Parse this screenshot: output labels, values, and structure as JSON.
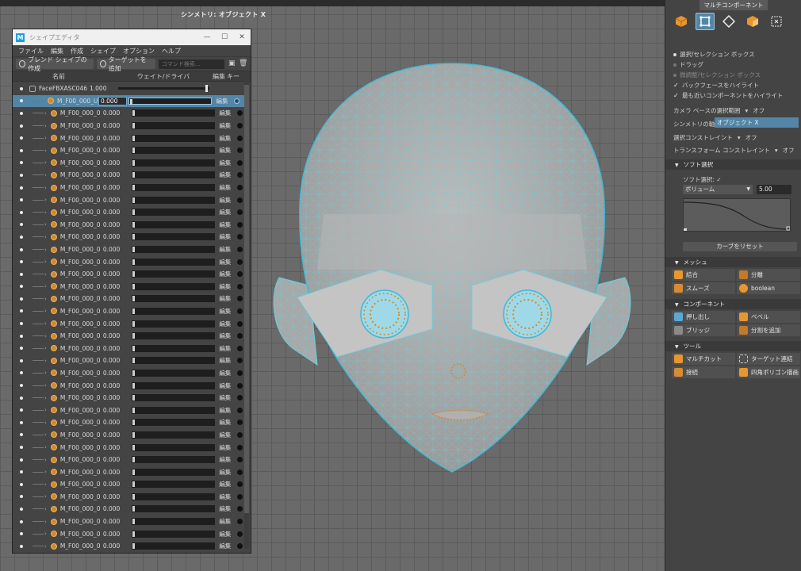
{
  "viewport": {
    "symmetry_label": "シンメトリ: オブジェクト X"
  },
  "shape_editor": {
    "title": "シェイプエディタ",
    "menus": [
      "ファイル",
      "編集",
      "作成",
      "シェイプ",
      "オプション",
      "ヘルプ"
    ],
    "toolbar": {
      "create_blend_shape": "ブレンド シェイプの作成",
      "add_target": "ターゲットを追加",
      "search_placeholder": "コマンド検索..."
    },
    "columns": {
      "name": "名前",
      "weight": "ウェイト/ドライバ",
      "edit": "編集",
      "key": "キー"
    },
    "group": {
      "name": "FaceFBXASC046",
      "value": "1.000"
    },
    "selected_row": {
      "name": "M_F00_000_U",
      "value": "0.000",
      "edit": "編集"
    },
    "rows": [
      {
        "name": "M_F00_000_0",
        "value": "0.000",
        "edit": "編集"
      },
      {
        "name": "M_F00_000_0",
        "value": "0.000",
        "edit": "編集"
      },
      {
        "name": "M_F00_000_0",
        "value": "0.000",
        "edit": "編集"
      },
      {
        "name": "M_F00_000_0",
        "value": "0.000",
        "edit": "編集"
      },
      {
        "name": "M_F00_000_0",
        "value": "0.000",
        "edit": "編集"
      },
      {
        "name": "M_F00_000_0",
        "value": "0.000",
        "edit": "編集"
      },
      {
        "name": "M_F00_000_0",
        "value": "0.000",
        "edit": "編集"
      },
      {
        "name": "M_F00_000_0",
        "value": "0.000",
        "edit": "編集"
      },
      {
        "name": "M_F00_000_0",
        "value": "0.000",
        "edit": "編集"
      },
      {
        "name": "M_F00_000_0",
        "value": "0.000",
        "edit": "編集"
      },
      {
        "name": "M_F00_000_0",
        "value": "0.000",
        "edit": "編集"
      },
      {
        "name": "M_F00_000_0",
        "value": "0.000",
        "edit": "編集"
      },
      {
        "name": "M_F00_000_0",
        "value": "0.000",
        "edit": "編集"
      },
      {
        "name": "M_F00_000_0",
        "value": "0.000",
        "edit": "編集"
      },
      {
        "name": "M_F00_000_0",
        "value": "0.000",
        "edit": "編集"
      },
      {
        "name": "M_F00_000_0",
        "value": "0.000",
        "edit": "編集"
      },
      {
        "name": "M_F00_000_0",
        "value": "0.000",
        "edit": "編集"
      },
      {
        "name": "M_F00_000_0",
        "value": "0.000",
        "edit": "編集"
      },
      {
        "name": "M_F00_000_0",
        "value": "0.000",
        "edit": "編集"
      },
      {
        "name": "M_F00_000_0",
        "value": "0.000",
        "edit": "編集"
      },
      {
        "name": "M_F00_000_0",
        "value": "0.000",
        "edit": "編集"
      },
      {
        "name": "M_F00_000_0",
        "value": "0.000",
        "edit": "編集"
      },
      {
        "name": "M_F00_000_0",
        "value": "0.000",
        "edit": "編集"
      },
      {
        "name": "M_F00_000_0",
        "value": "0.000",
        "edit": "編集"
      },
      {
        "name": "M_F00_000_0",
        "value": "0.000",
        "edit": "編集"
      },
      {
        "name": "M_F00_000_0",
        "value": "0.000",
        "edit": "編集"
      },
      {
        "name": "M_F00_000_0",
        "value": "0.000",
        "edit": "編集"
      },
      {
        "name": "M_F00_000_0",
        "value": "0.000",
        "edit": "編集"
      },
      {
        "name": "M_F00_000_0",
        "value": "0.000",
        "edit": "編集"
      },
      {
        "name": "M_F00_000_0",
        "value": "0.000",
        "edit": "編集"
      },
      {
        "name": "M_F00_000_0",
        "value": "0.000",
        "edit": "編集"
      },
      {
        "name": "M_F00_000_0",
        "value": "0.000",
        "edit": "編集"
      },
      {
        "name": "M_F00_000_0",
        "value": "0.000",
        "edit": "編集"
      },
      {
        "name": "M_F00_000_0",
        "value": "0.000",
        "edit": "編集"
      },
      {
        "name": "M_F00_000_0",
        "value": "0.000",
        "edit": "編集"
      },
      {
        "name": "M_F00_000_0",
        "value": "0.000",
        "edit": "編集"
      }
    ]
  },
  "right_panel": {
    "tab": "マルチコンポーネント",
    "options": {
      "select_box": "選択/セレクション ボックス",
      "drag": "ドラッグ",
      "tweak_box": "微調整/セレクション ボックス",
      "highlight_backface": "バックフェースをハイライト",
      "highlight_nearest": "最も近いコンポーネントをハイライト"
    },
    "camera_range": {
      "label": "カメラ ベースの選択範囲",
      "value": "オフ"
    },
    "symmetry_axis": {
      "label": "シンメトリの軸",
      "value": "オブジェクト X"
    },
    "selection_constraint": {
      "label": "選択コンストレイント",
      "value": "オフ"
    },
    "transform_constraint": {
      "label": "トランスフォーム コンストレイント",
      "value": "オフ"
    },
    "soft_selection": {
      "header": "ソフト選択",
      "toggle_label": "ソフト選択:",
      "falloff_mode": "ボリューム",
      "falloff_radius": "5.00",
      "reset_curve": "カーブをリセット"
    },
    "mesh": {
      "header": "メッシュ",
      "tools": [
        "結合",
        "分離",
        "スムーズ",
        "boolean"
      ]
    },
    "component": {
      "header": "コンポーネント",
      "tools": [
        "押し出し",
        "ベベル",
        "ブリッジ",
        "分割を追加"
      ]
    },
    "tools": {
      "header": "ツール",
      "tools": [
        "マルチカット",
        "ターゲット連結",
        "接続",
        "四角ポリゴン描画"
      ]
    }
  }
}
